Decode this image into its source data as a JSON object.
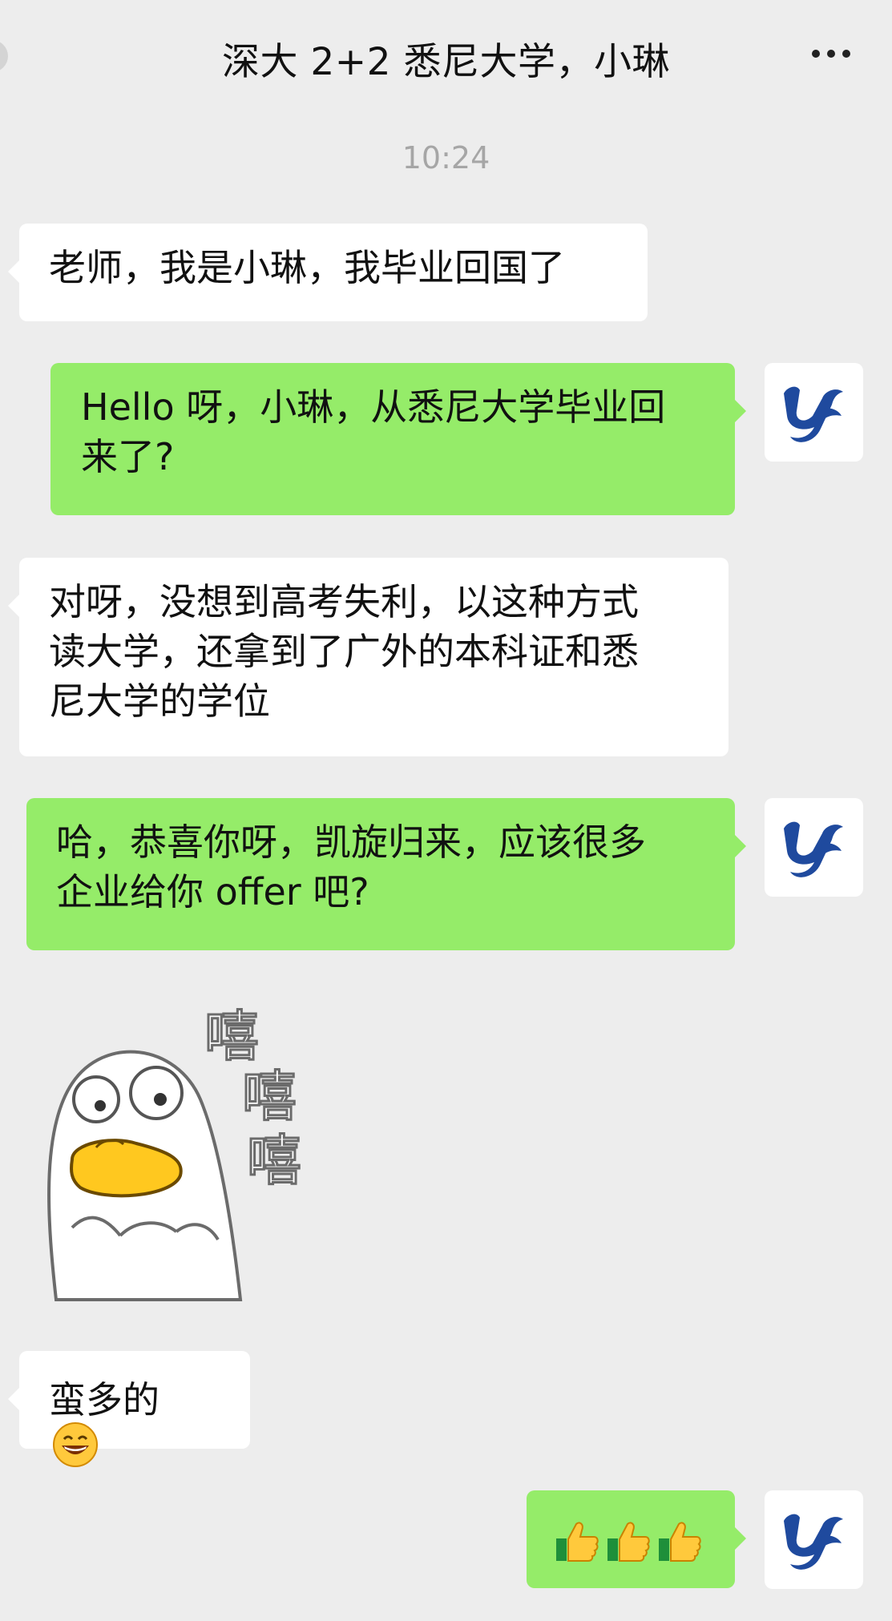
{
  "header": {
    "title": "深大 2+2 悉尼大学，小琳",
    "more_icon": "more-dots-icon"
  },
  "chat": {
    "timestamp": "10:24",
    "messages": [
      {
        "from": "contact",
        "text": "老师，我是小琳，我毕业回国了"
      },
      {
        "from": "me",
        "lines": [
          "Hello 呀，小琳，从悉尼大学毕业回",
          "来了?"
        ]
      },
      {
        "from": "contact",
        "lines": [
          "对呀，没想到高考失利，以这种方式",
          "读大学，还拿到了广外的本科证和悉",
          "尼大学的学位"
        ]
      },
      {
        "from": "me",
        "lines": [
          "哈，恭喜你呀，凯旋归来，应该很多",
          "企业给你 offer 吧?"
        ]
      },
      {
        "from": "contact",
        "type": "sticker",
        "sticker_text": "嘻嘻嘻",
        "icon": "duck-sticker"
      },
      {
        "from": "me_none",
        "text": ""
      },
      {
        "from": "contact",
        "text": "蛮多的",
        "emoji": "laughing-face-icon"
      },
      {
        "from": "me",
        "emoji": [
          "thumbs-up-icon",
          "thumbs-up-icon",
          "thumbs-up-icon"
        ]
      }
    ]
  },
  "colors": {
    "background": "#ededed",
    "outgoing_bubble": "#95ec69",
    "incoming_bubble": "#ffffff",
    "avatar_logo": "#1f4a9e"
  }
}
